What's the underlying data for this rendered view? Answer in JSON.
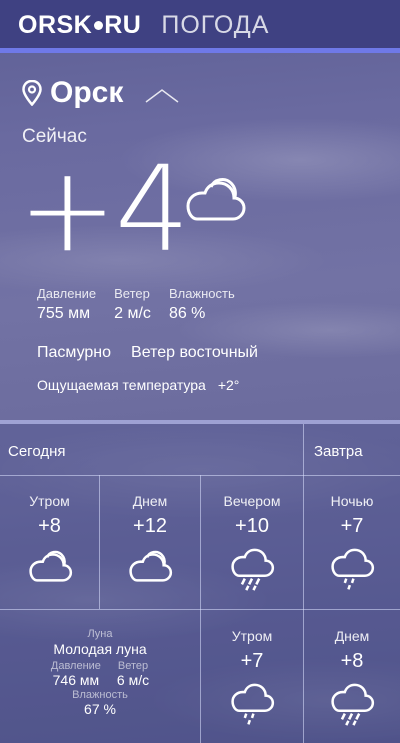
{
  "header": {
    "logo_left": "ORSK",
    "logo_right": "RU",
    "section": "ПОГОДА"
  },
  "city": {
    "name": "Орск"
  },
  "now": {
    "label": "Сейчас",
    "temperature": "+4",
    "icon": "cloud-icon",
    "pressure_label": "Давление",
    "pressure": "755 мм",
    "wind_label": "Ветер",
    "wind": "2 м/с",
    "humidity_label": "Влажность",
    "humidity": "86 %",
    "condition": "Пасмурно",
    "wind_direction": "Ветер восточный",
    "feels_label": "Ощущаемая температура",
    "feels": "+2°"
  },
  "forecast": {
    "today_label": "Сегодня",
    "tomorrow_label": "Завтра",
    "today": [
      {
        "period": "Утром",
        "temp": "+8",
        "icon": "cloud-icon"
      },
      {
        "period": "Днем",
        "temp": "+12",
        "icon": "cloud-icon"
      },
      {
        "period": "Вечером",
        "temp": "+10",
        "icon": "rain-cloud-icon"
      },
      {
        "period": "Ночью",
        "temp": "+7",
        "icon": "rain-cloud-icon"
      }
    ],
    "tomorrow": [
      {
        "period": "Утром",
        "temp": "+7",
        "icon": "rain-cloud-icon"
      },
      {
        "period": "Днем",
        "temp": "+8",
        "icon": "rain-cloud-icon"
      }
    ],
    "moon": {
      "label": "Луна",
      "phase": "Молодая луна",
      "pressure_label": "Давление",
      "pressure": "746 мм",
      "wind_label": "Ветер",
      "wind": "6 м/с",
      "humidity_label": "Влажность",
      "humidity": "67 %"
    }
  },
  "colors": {
    "header": "#3f4182",
    "accent_line": "#6f79e8"
  }
}
